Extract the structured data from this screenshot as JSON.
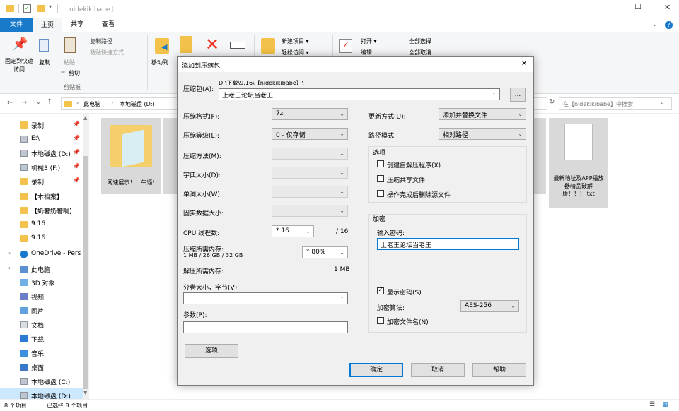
{
  "window": {
    "title": "｜nidekikibabe｜",
    "minimize": "─",
    "maximize": "☐",
    "close": "✕"
  },
  "ribbon": {
    "tabs": [
      "文件",
      "主页",
      "共享",
      "查看"
    ],
    "pin_label": "固定到快速访问",
    "copy_label": "复制",
    "paste_label": "粘贴",
    "copy_path": "复制路径",
    "paste_shortcut": "粘贴快捷方式",
    "cut": "剪切",
    "clipboard_group": "剪贴板",
    "moveto": "移动到",
    "new_item": "新建项目 ▾",
    "easy_access": "轻松访问 ▾",
    "open": "打开 ▾",
    "edit": "编辑",
    "select_all": "全部选择",
    "select_none": "全部取消"
  },
  "address": {
    "path_pc": "此电脑",
    "path_disk": "本地磁盘 (D:)",
    "search_placeholder": "在【nidekikibabe】中搜索"
  },
  "nav": {
    "items": [
      {
        "label": "录制",
        "icon": "folder"
      },
      {
        "label": "E:\\",
        "icon": "drive"
      },
      {
        "label": "本地磁盘 (D:)",
        "icon": "drive"
      },
      {
        "label": "机械3 (F:)",
        "icon": "drive"
      },
      {
        "label": "录制",
        "icon": "folder"
      },
      {
        "label": "【本档案】",
        "icon": "folder"
      },
      {
        "label": "【奶奢奶奢啊】",
        "icon": "folder"
      },
      {
        "label": "9.16",
        "icon": "folder"
      },
      {
        "label": "9.16",
        "icon": "folder"
      },
      {
        "label": "OneDrive - Pers",
        "icon": "cloud"
      },
      {
        "label": "此电脑",
        "icon": "pc"
      },
      {
        "label": "3D 对象",
        "icon": "cube"
      },
      {
        "label": "视频",
        "icon": "video"
      },
      {
        "label": "图片",
        "icon": "picture"
      },
      {
        "label": "文档",
        "icon": "doc"
      },
      {
        "label": "下载",
        "icon": "download"
      },
      {
        "label": "音乐",
        "icon": "music"
      },
      {
        "label": "桌面",
        "icon": "desktop"
      },
      {
        "label": "本地磁盘 (C:)",
        "icon": "drive"
      },
      {
        "label": "本地磁盘 (D:)",
        "icon": "drive"
      }
    ]
  },
  "files": {
    "left_name": "网速展示！！牛逼!",
    "right_name": "最新地址及APP播放器精品破解版！！！.txt"
  },
  "status": {
    "count": "8 个项目",
    "selected": "已选择 8 个项目"
  },
  "dialog": {
    "title": "添加到压缩包",
    "close": "✕",
    "archive_label": "压缩包(A):",
    "archive_dir": "D:\\下载\\9.16\\【nidekikibabe】\\",
    "archive_name": "上老王论坛当老王",
    "browse": "...",
    "format_label": "压缩格式(F):",
    "format_value": "7z",
    "level_label": "压缩等级(L):",
    "level_value": "0 - 仅存储",
    "method_label": "压缩方法(M):",
    "dict_label": "字典大小(D):",
    "word_label": "单词大小(W):",
    "solid_label": "固实数据大小:",
    "cpu_label": "CPU 线程数:",
    "cpu_value": "* 16",
    "cpu_total": "/ 16",
    "mem_label": "压缩所需内存:",
    "mem_detail": "1 MB / 26 GB / 32 GB",
    "mem_value": "* 80%",
    "decomp_label": "解压所需内存:",
    "decomp_value": "1 MB",
    "split_label": "分卷大小，字节(V):",
    "params_label": "参数(P):",
    "options_btn": "选项",
    "update_label": "更新方式(U):",
    "update_value": "添加并替换文件",
    "path_label": "路径模式",
    "path_value": "相对路径",
    "options_group": "选项",
    "opt_sfx": "创建自解压程序(X)",
    "opt_shared": "压缩共享文件",
    "opt_delete": "操作完成后删除源文件",
    "enc_group": "加密",
    "pwd_label": "输入密码:",
    "pwd_value": "上老王论坛当老王",
    "show_pwd": "显示密码(S)",
    "enc_method_label": "加密算法:",
    "enc_method_value": "AES-256",
    "enc_names": "加密文件名(N)",
    "ok": "确定",
    "cancel": "取消",
    "help": "帮助"
  }
}
